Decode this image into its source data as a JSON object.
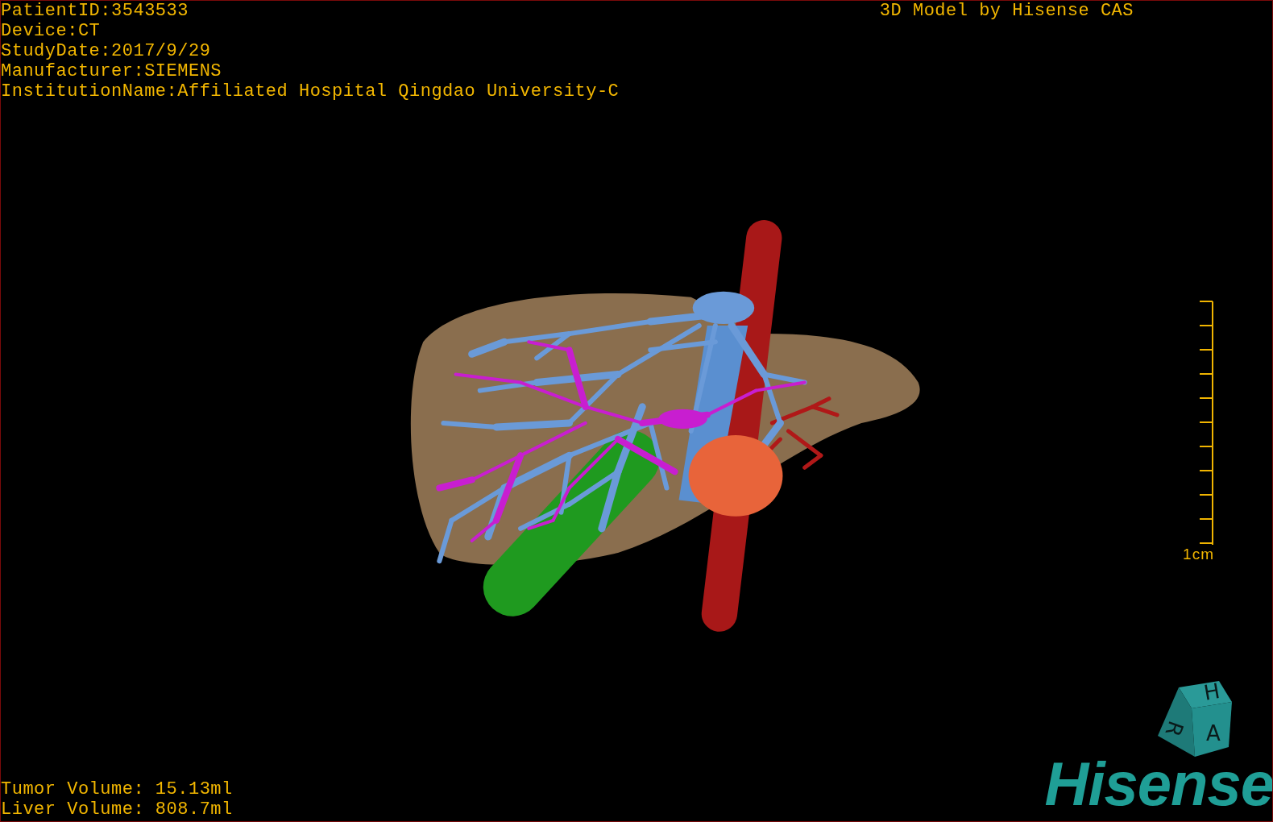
{
  "patient_info": [
    "PatientID:3543533",
    "Device:CT",
    "StudyDate:2017/9/29",
    "Manufacturer:SIEMENS",
    "InstitutionName:Affiliated Hospital Qingdao University-C"
  ],
  "title": "3D Model by Hisense CAS",
  "scale_bar": {
    "label": "1cm"
  },
  "volumes": [
    "Tumor Volume: 15.13ml",
    "Liver Volume: 808.7ml"
  ],
  "orientation_cube": {
    "faces": [
      "H",
      "R",
      "A"
    ]
  },
  "logo": "Hisense"
}
